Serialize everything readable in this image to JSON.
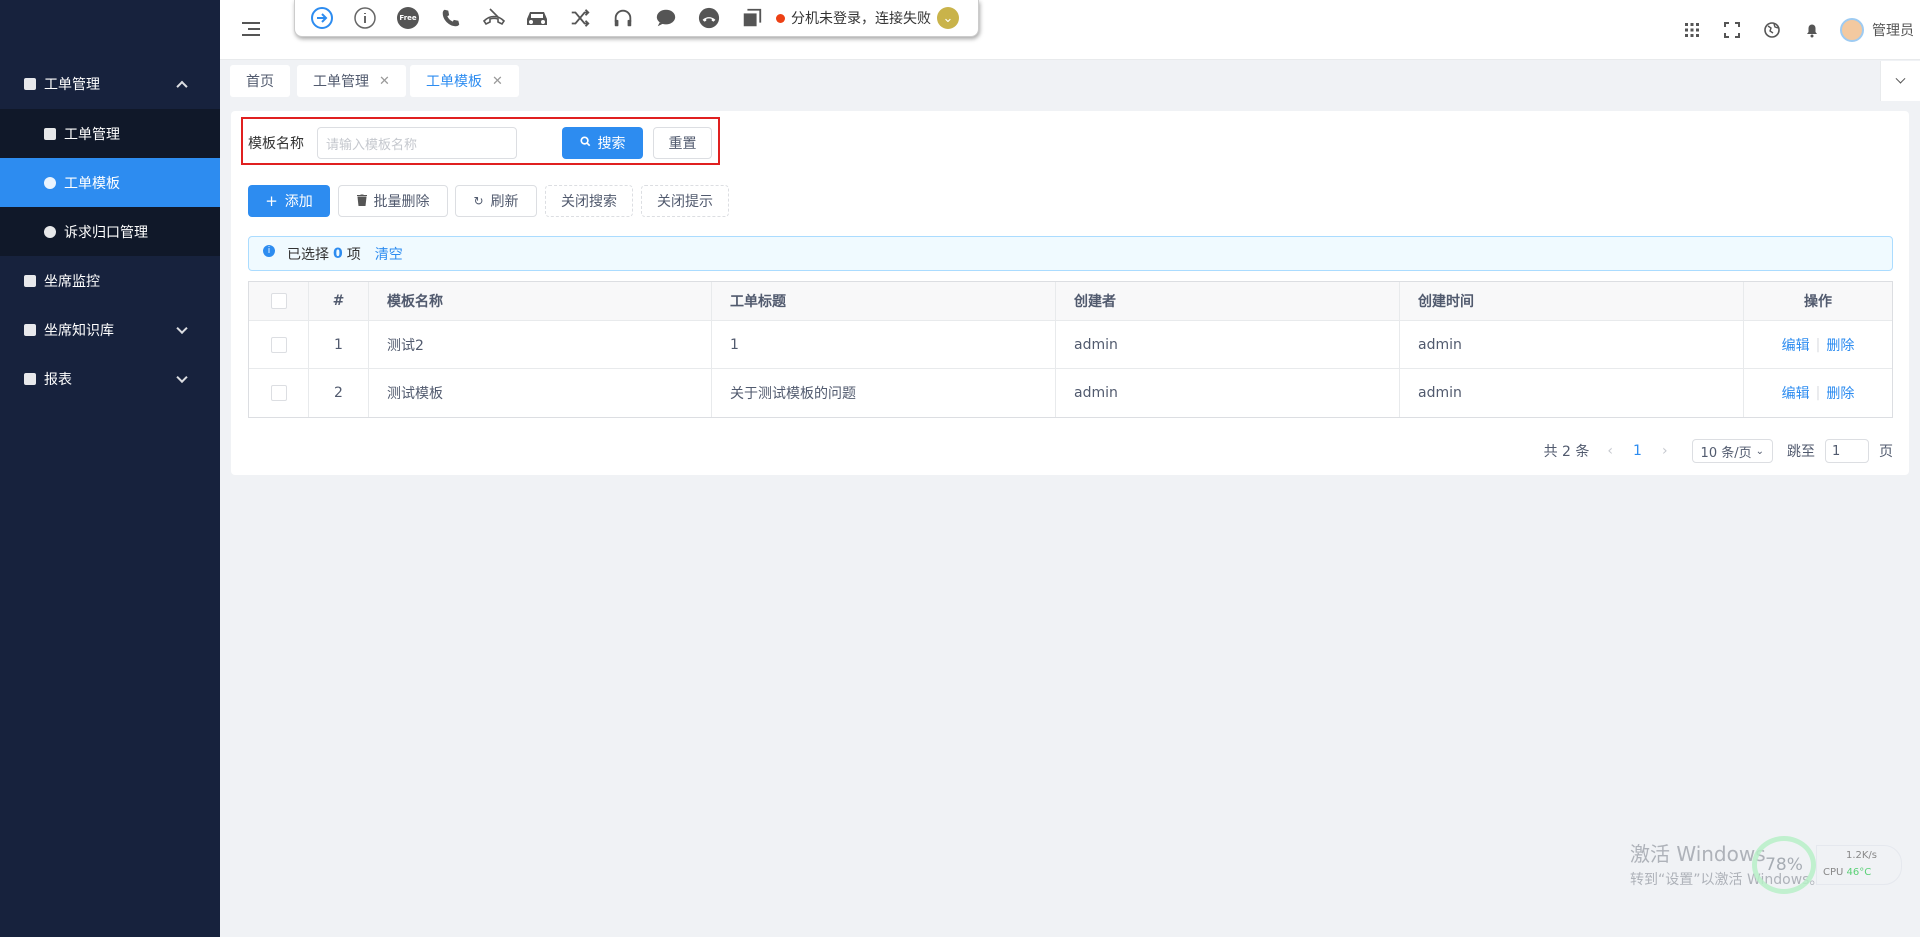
{
  "sidebar": {
    "group_label": "工单管理",
    "items": [
      {
        "label": "工单管理"
      },
      {
        "label": "工单模板"
      },
      {
        "label": "诉求归口管理"
      }
    ],
    "top_items": [
      {
        "label": "坐席监控"
      },
      {
        "label": "坐席知识库"
      },
      {
        "label": "报表"
      }
    ]
  },
  "phonebar": {
    "icons": [
      "sign-in-icon",
      "info-icon",
      "free-icon",
      "phone-icon",
      "hangup-icon",
      "car-icon",
      "shuffle-icon",
      "headset-icon",
      "chat-icon",
      "end-call-icon",
      "copy-icon"
    ],
    "free_label": "Free",
    "status_text": "分机未登录，连接失败",
    "status_color": "#ed4014"
  },
  "header": {
    "user_name": "管理员"
  },
  "tabs": [
    {
      "label": "首页"
    },
    {
      "label": "工单管理"
    },
    {
      "label": "工单模板"
    }
  ],
  "search": {
    "label": "模板名称",
    "placeholder": "请输入模板名称",
    "search_button": "搜索",
    "reset_button": "重置"
  },
  "toolbar": {
    "add": "添加",
    "batch_delete": "批量删除",
    "refresh": "刷新",
    "close_search": "关闭搜索",
    "close_tip": "关闭提示"
  },
  "alert": {
    "prefix": "已选择",
    "count": "0",
    "suffix": "项",
    "clear": "清空"
  },
  "table": {
    "headers": [
      "#",
      "模板名称",
      "工单标题",
      "创建者",
      "创建时间",
      "操作"
    ],
    "rows": [
      {
        "index": "1",
        "name": "测试2",
        "title": "1",
        "creator": "admin",
        "created_at": "admin",
        "edit": "编辑",
        "delete": "删除"
      },
      {
        "index": "2",
        "name": "测试模板",
        "title": "关于测试模板的问题",
        "creator": "admin",
        "created_at": "admin",
        "edit": "编辑",
        "delete": "删除"
      }
    ]
  },
  "pager": {
    "total": "共 2 条",
    "current": "1",
    "page_size": "10 条/页",
    "jump_label": "跳至",
    "jump_value": "1",
    "page_label": "页"
  },
  "watermark": {
    "line1": "激活 Windows",
    "line2": "转到“设置”以激活 Windows。",
    "cpu_percent": "78%",
    "net_speed": "1.2K/s",
    "cpu_label": "CPU",
    "cpu_temp": "46°C"
  },
  "colors": {
    "sidebar_bg": "#17223d",
    "accent": "#2d8cf0",
    "highlight_border": "#e02020"
  }
}
